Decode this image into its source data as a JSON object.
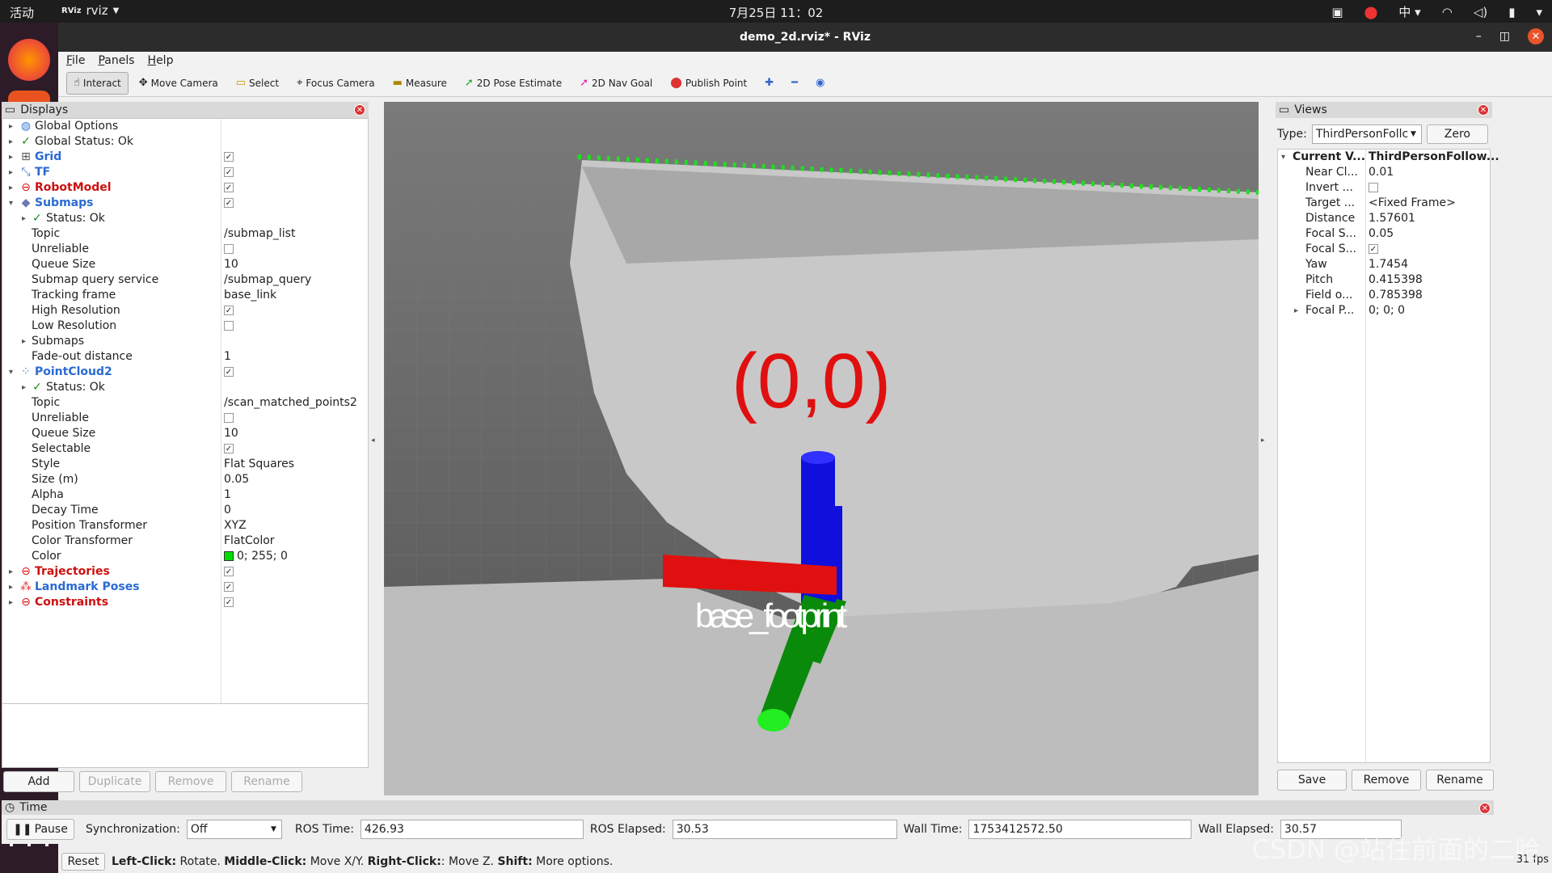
{
  "topbar": {
    "activities": "活动",
    "app_name": "rviz",
    "clock": "7月25日 11：02",
    "ime": "中"
  },
  "window": {
    "title": "demo_2d.rviz* - RViz"
  },
  "menu": {
    "file": "File",
    "panels": "Panels",
    "help": "Help"
  },
  "toolbar": {
    "interact": "Interact",
    "move_camera": "Move Camera",
    "select": "Select",
    "focus_camera": "Focus Camera",
    "measure": "Measure",
    "pose_estimate": "2D Pose Estimate",
    "nav_goal": "2D Nav Goal",
    "publish_point": "Publish Point"
  },
  "displays": {
    "title": "Displays",
    "rows": [
      {
        "indent": 0,
        "arrow": "▸",
        "icon": "globe",
        "label": "Global Options",
        "cls": "",
        "value": "",
        "check": ""
      },
      {
        "indent": 0,
        "arrow": "▸",
        "icon": "tick",
        "label": "Global Status: Ok",
        "cls": "",
        "value": "",
        "check": ""
      },
      {
        "indent": 0,
        "arrow": "▸",
        "icon": "grid",
        "label": "Grid",
        "cls": "blue",
        "value": "",
        "check": "on"
      },
      {
        "indent": 0,
        "arrow": "▸",
        "icon": "tf",
        "label": "TF",
        "cls": "blue",
        "value": "",
        "check": "on"
      },
      {
        "indent": 0,
        "arrow": "▸",
        "icon": "err",
        "label": "RobotModel",
        "cls": "red",
        "value": "",
        "check": "on"
      },
      {
        "indent": 0,
        "arrow": "▾",
        "icon": "sub",
        "label": "Submaps",
        "cls": "blue",
        "value": "",
        "check": "on"
      },
      {
        "indent": 1,
        "arrow": "▸",
        "icon": "tick",
        "label": "Status: Ok",
        "cls": "",
        "value": "",
        "check": ""
      },
      {
        "indent": 1,
        "arrow": "",
        "icon": "",
        "label": "Topic",
        "cls": "",
        "value": "/submap_list",
        "check": ""
      },
      {
        "indent": 1,
        "arrow": "",
        "icon": "",
        "label": "Unreliable",
        "cls": "",
        "value": "",
        "check": "off"
      },
      {
        "indent": 1,
        "arrow": "",
        "icon": "",
        "label": "Queue Size",
        "cls": "",
        "value": "10",
        "check": ""
      },
      {
        "indent": 1,
        "arrow": "",
        "icon": "",
        "label": "Submap query service",
        "cls": "",
        "value": "/submap_query",
        "check": ""
      },
      {
        "indent": 1,
        "arrow": "",
        "icon": "",
        "label": "Tracking frame",
        "cls": "",
        "value": "base_link",
        "check": ""
      },
      {
        "indent": 1,
        "arrow": "",
        "icon": "",
        "label": "High Resolution",
        "cls": "",
        "value": "",
        "check": "on"
      },
      {
        "indent": 1,
        "arrow": "",
        "icon": "",
        "label": "Low Resolution",
        "cls": "",
        "value": "",
        "check": "off"
      },
      {
        "indent": 1,
        "arrow": "▸",
        "icon": "",
        "label": "Submaps",
        "cls": "",
        "value": "",
        "check": ""
      },
      {
        "indent": 1,
        "arrow": "",
        "icon": "",
        "label": "Fade-out distance",
        "cls": "",
        "value": "1",
        "check": ""
      },
      {
        "indent": 0,
        "arrow": "▾",
        "icon": "pc",
        "label": "PointCloud2",
        "cls": "blue",
        "value": "",
        "check": "on"
      },
      {
        "indent": 1,
        "arrow": "▸",
        "icon": "tick",
        "label": "Status: Ok",
        "cls": "",
        "value": "",
        "check": ""
      },
      {
        "indent": 1,
        "arrow": "",
        "icon": "",
        "label": "Topic",
        "cls": "",
        "value": "/scan_matched_points2",
        "check": ""
      },
      {
        "indent": 1,
        "arrow": "",
        "icon": "",
        "label": "Unreliable",
        "cls": "",
        "value": "",
        "check": "off"
      },
      {
        "indent": 1,
        "arrow": "",
        "icon": "",
        "label": "Queue Size",
        "cls": "",
        "value": "10",
        "check": ""
      },
      {
        "indent": 1,
        "arrow": "",
        "icon": "",
        "label": "Selectable",
        "cls": "",
        "value": "",
        "check": "on"
      },
      {
        "indent": 1,
        "arrow": "",
        "icon": "",
        "label": "Style",
        "cls": "",
        "value": "Flat Squares",
        "check": ""
      },
      {
        "indent": 1,
        "arrow": "",
        "icon": "",
        "label": "Size (m)",
        "cls": "",
        "value": "0.05",
        "check": ""
      },
      {
        "indent": 1,
        "arrow": "",
        "icon": "",
        "label": "Alpha",
        "cls": "",
        "value": "1",
        "check": ""
      },
      {
        "indent": 1,
        "arrow": "",
        "icon": "",
        "label": "Decay Time",
        "cls": "",
        "value": "0",
        "check": ""
      },
      {
        "indent": 1,
        "arrow": "",
        "icon": "",
        "label": "Position Transformer",
        "cls": "",
        "value": "XYZ",
        "check": ""
      },
      {
        "indent": 1,
        "arrow": "",
        "icon": "",
        "label": "Color Transformer",
        "cls": "",
        "value": "FlatColor",
        "check": ""
      },
      {
        "indent": 1,
        "arrow": "",
        "icon": "",
        "label": "Color",
        "cls": "",
        "value": "0; 255; 0",
        "check": "",
        "swatch": "#00dd00"
      },
      {
        "indent": 0,
        "arrow": "▸",
        "icon": "err",
        "label": "Trajectories",
        "cls": "red",
        "value": "",
        "check": "on"
      },
      {
        "indent": 0,
        "arrow": "▸",
        "icon": "lm",
        "label": "Landmark Poses",
        "cls": "blue",
        "value": "",
        "check": "on"
      },
      {
        "indent": 0,
        "arrow": "▸",
        "icon": "err",
        "label": "Constraints",
        "cls": "red",
        "value": "",
        "check": "on"
      }
    ],
    "buttons": {
      "add": "Add",
      "duplicate": "Duplicate",
      "remove": "Remove",
      "rename": "Rename"
    }
  },
  "viewport": {
    "origin_label": "(0,0)",
    "frame_label": "base_footprint"
  },
  "views": {
    "title": "Views",
    "type_label": "Type:",
    "type_value": "ThirdPersonFollc",
    "zero": "Zero",
    "rows": [
      {
        "indent": 0,
        "arrow": "▾",
        "label": "Current V...",
        "value": "ThirdPersonFollow...",
        "bold": true
      },
      {
        "indent": 1,
        "arrow": "",
        "label": "Near Cl...",
        "value": "0.01"
      },
      {
        "indent": 1,
        "arrow": "",
        "label": "Invert ...",
        "value": "",
        "check": "off"
      },
      {
        "indent": 1,
        "arrow": "",
        "label": "Target ...",
        "value": "<Fixed Frame>"
      },
      {
        "indent": 1,
        "arrow": "",
        "label": "Distance",
        "value": "1.57601"
      },
      {
        "indent": 1,
        "arrow": "",
        "label": "Focal S...",
        "value": "0.05"
      },
      {
        "indent": 1,
        "arrow": "",
        "label": "Focal S...",
        "value": "",
        "check": "on"
      },
      {
        "indent": 1,
        "arrow": "",
        "label": "Yaw",
        "value": "1.7454"
      },
      {
        "indent": 1,
        "arrow": "",
        "label": "Pitch",
        "value": "0.415398"
      },
      {
        "indent": 1,
        "arrow": "",
        "label": "Field o...",
        "value": "0.785398"
      },
      {
        "indent": 1,
        "arrow": "▸",
        "label": "Focal P...",
        "value": "0; 0; 0"
      }
    ],
    "buttons": {
      "save": "Save",
      "remove": "Remove",
      "rename": "Rename"
    }
  },
  "time": {
    "title": "Time",
    "pause": "Pause",
    "sync_label": "Synchronization:",
    "sync_value": "Off",
    "ros_time_label": "ROS Time:",
    "ros_time": "426.93",
    "ros_elapsed_label": "ROS Elapsed:",
    "ros_elapsed": "30.53",
    "wall_time_label": "Wall Time:",
    "wall_time": "1753412572.50",
    "wall_elapsed_label": "Wall Elapsed:",
    "wall_elapsed": "30.57"
  },
  "status": {
    "reset": "Reset",
    "hint_lc": "Left-Click:",
    "hint_lc_t": "Rotate.",
    "hint_mc": "Middle-Click:",
    "hint_mc_t": "Move X/Y.",
    "hint_rc": "Right-Click:",
    "hint_rc_t": ": Move Z.",
    "hint_sh": "Shift:",
    "hint_sh_t": "More options.",
    "fps": "31 fps"
  },
  "watermark": "CSDN @站住前面的二哈",
  "colors": {
    "accent_blue": "#2a6ad4",
    "error_red": "#cc1010",
    "point_green": "#00dd00"
  }
}
